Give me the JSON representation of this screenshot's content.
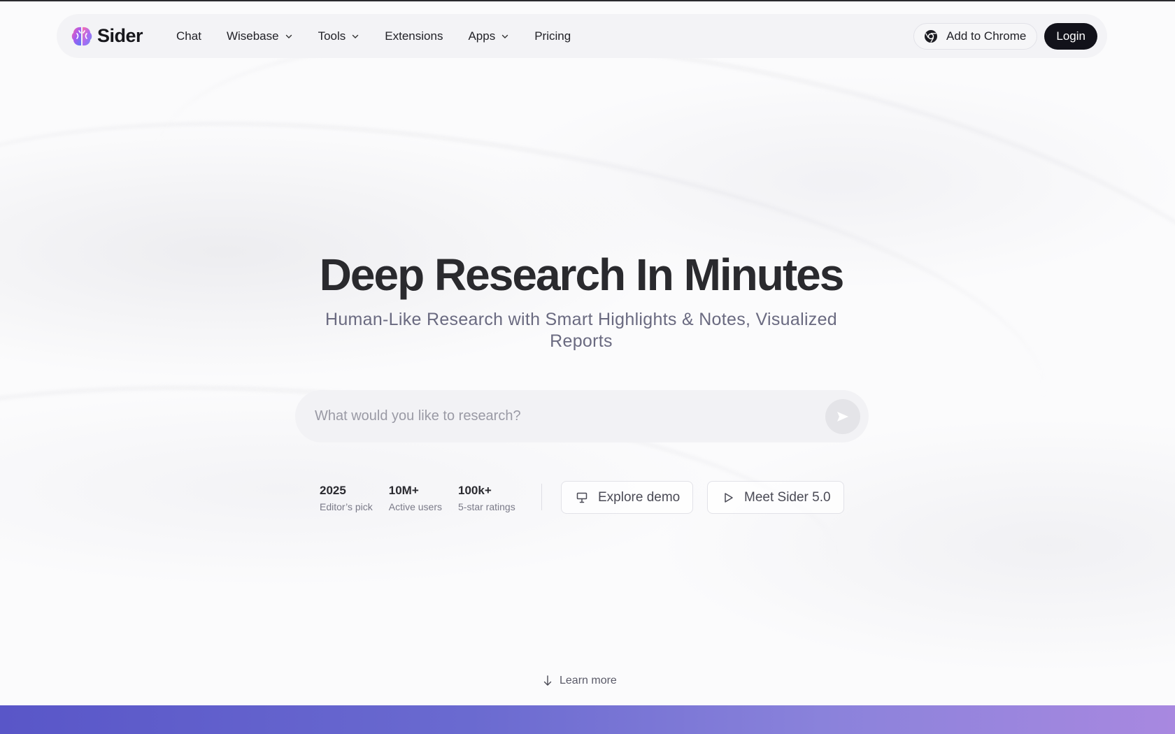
{
  "brand": {
    "name": "Sider",
    "logo_icon": "brain-logo-icon"
  },
  "nav": {
    "items": [
      {
        "label": "Chat",
        "has_dropdown": false
      },
      {
        "label": "Wisebase",
        "has_dropdown": true
      },
      {
        "label": "Tools",
        "has_dropdown": true
      },
      {
        "label": "Extensions",
        "has_dropdown": false
      },
      {
        "label": "Apps",
        "has_dropdown": true
      },
      {
        "label": "Pricing",
        "has_dropdown": false
      }
    ],
    "add_to_chrome_label": "Add to Chrome",
    "login_label": "Login"
  },
  "hero": {
    "title": "Deep Research In Minutes",
    "subtitle": "Human-Like Research with Smart Highlights & Notes, Visualized Reports",
    "search_placeholder": "What would you like to research?"
  },
  "stats": [
    {
      "value": "2025",
      "label": "Editor’s pick"
    },
    {
      "value": "10M+",
      "label": "Active users"
    },
    {
      "value": "100k+",
      "label": "5-star ratings"
    }
  ],
  "buttons": {
    "explore_demo": "Explore demo",
    "meet_sider": "Meet Sider 5.0"
  },
  "learn_more": "Learn more",
  "colors": {
    "accent_dark": "#12121a",
    "band_start": "#5956c8",
    "band_end": "#a888e0"
  }
}
